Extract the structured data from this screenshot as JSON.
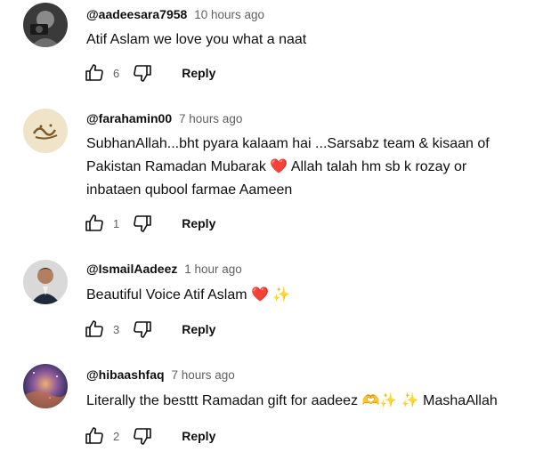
{
  "comments": [
    {
      "handle": "@aadeesara7958",
      "time": "10 hours ago",
      "text": "Atif Aslam we love you what a naat",
      "likes": "6",
      "reply": "Reply"
    },
    {
      "handle": "@farahamin00",
      "time": "7 hours ago",
      "text_lines": [
        "SubhanAllah...bht pyara kalaam hai ...Sarsabz team & kisaan of",
        "Pakistan Ramadan Mubarak ❤️  Allah talah hm sb k rozay or",
        "inbataen qubool farmae Aameen"
      ],
      "likes": "1",
      "reply": "Reply"
    },
    {
      "handle": "@IsmailAadeez",
      "time": "1 hour ago",
      "text": "Beautiful Voice Atif Aslam ❤️ ✨",
      "likes": "3",
      "reply": "Reply"
    },
    {
      "handle": "@hibaashfaq",
      "time": "7 hours ago",
      "text": "Literally the besttt Ramadan gift for aadeez 🫶✨ ✨  MashaAllah",
      "likes": "2",
      "reply": "Reply"
    }
  ],
  "icons": {
    "like": "thumbs-up-icon",
    "dislike": "thumbs-down-icon"
  },
  "colors": {
    "text": "#0f0f0f",
    "meta": "#606060",
    "heart": "#e0245e"
  }
}
